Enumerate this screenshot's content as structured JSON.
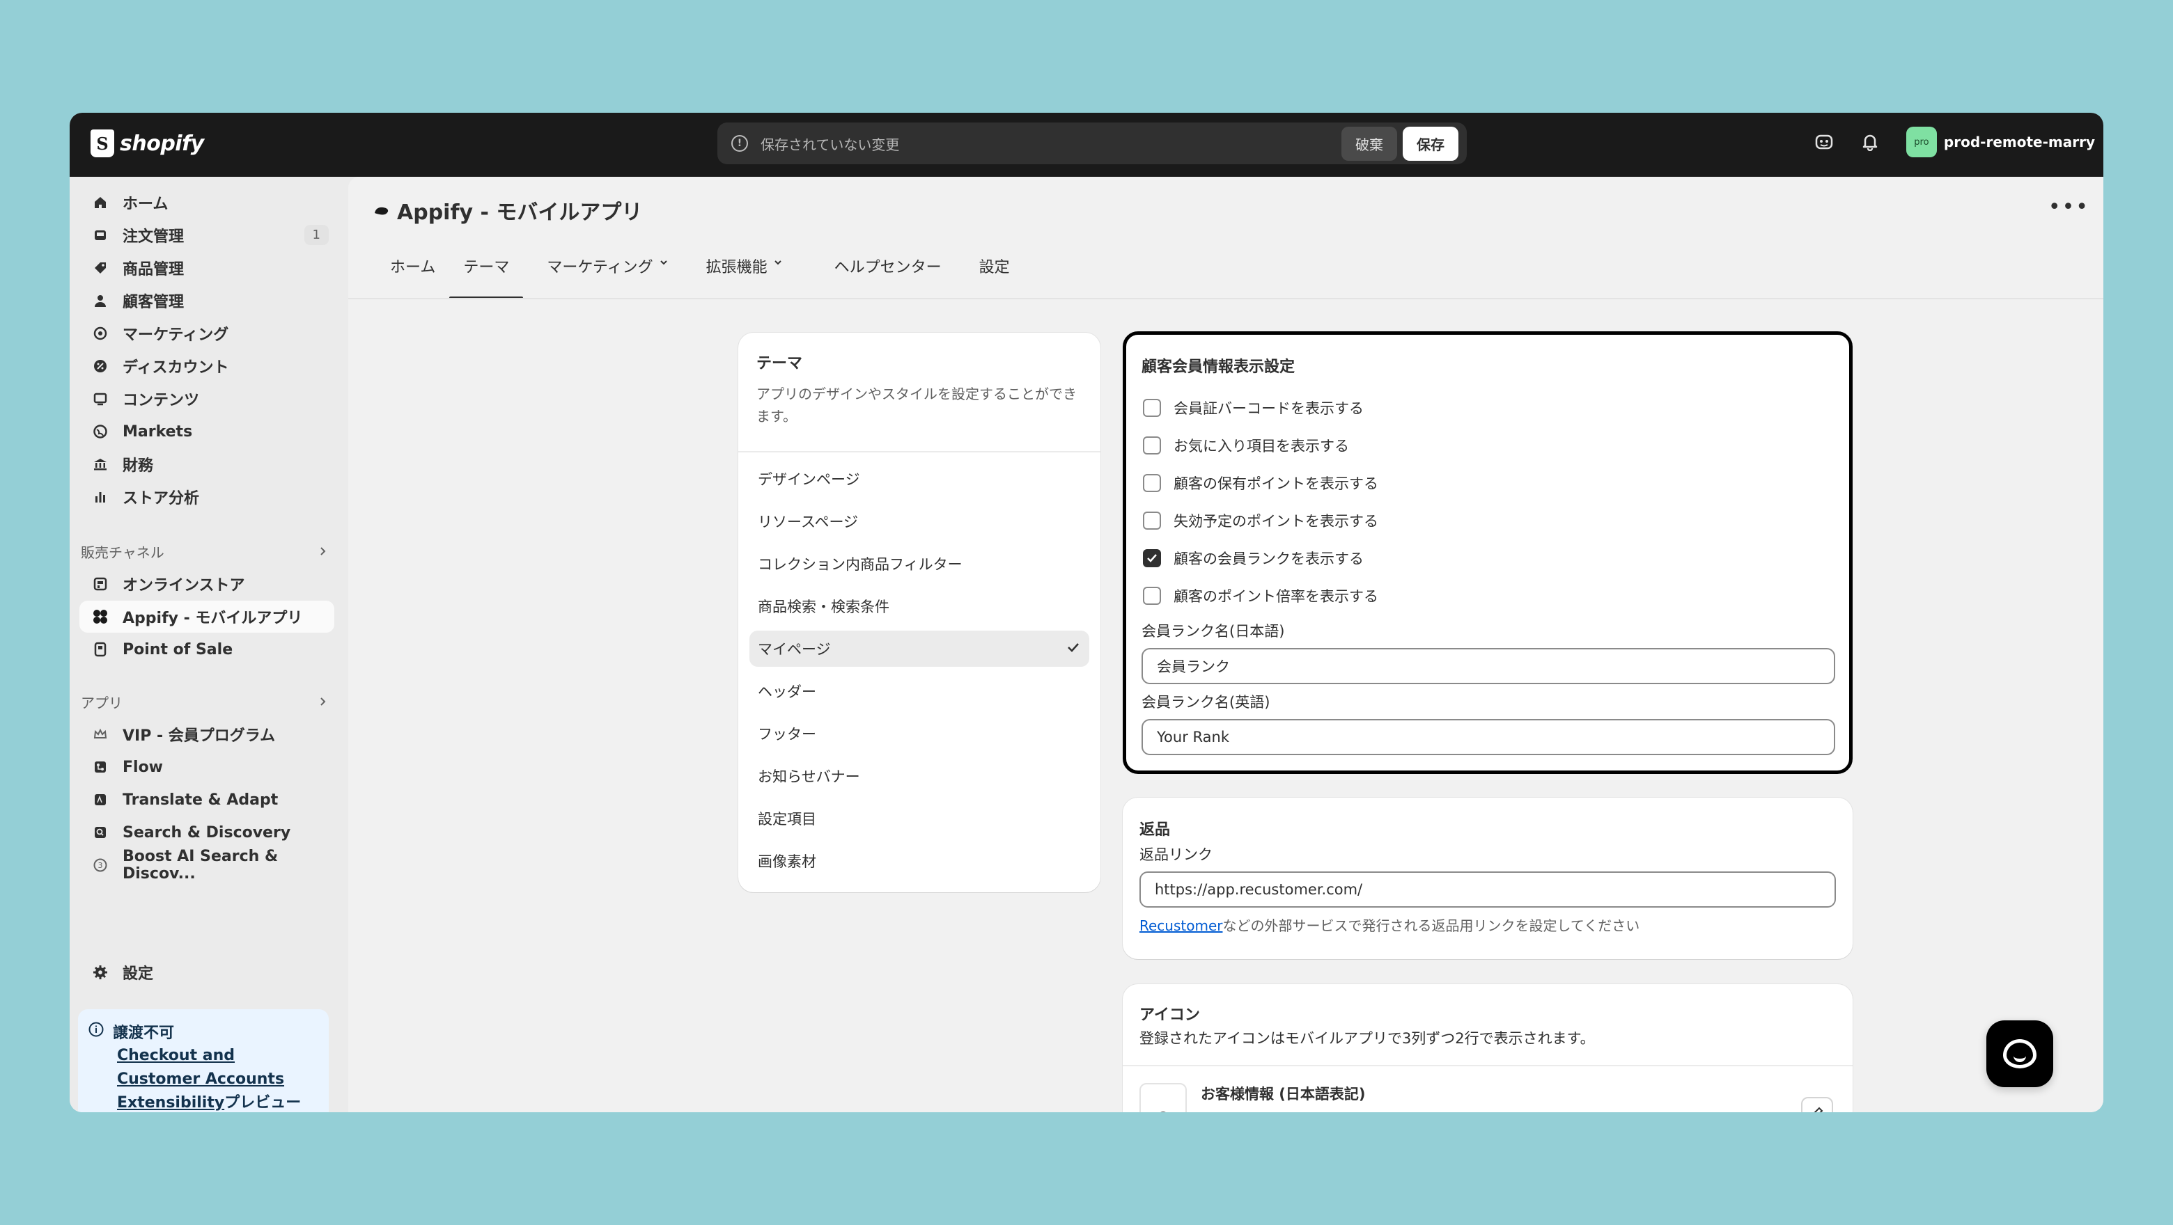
{
  "topbar": {
    "logo_text": "shopify",
    "savebar_text": "保存されていない変更",
    "discard_label": "破棄",
    "save_label": "保存",
    "avatar_text": "pro",
    "store_name": "prod-remote-marry"
  },
  "sidebar": {
    "items": [
      {
        "label": "ホーム",
        "icon": "home-icon"
      },
      {
        "label": "注文管理",
        "icon": "inbox-icon",
        "badge": "1"
      },
      {
        "label": "商品管理",
        "icon": "tag-icon"
      },
      {
        "label": "顧客管理",
        "icon": "person-icon"
      },
      {
        "label": "マーケティング",
        "icon": "target-icon"
      },
      {
        "label": "ディスカウント",
        "icon": "discount-icon"
      },
      {
        "label": "コンテンツ",
        "icon": "content-icon"
      },
      {
        "label": "Markets",
        "icon": "globe-icon"
      },
      {
        "label": "財務",
        "icon": "bank-icon"
      },
      {
        "label": "ストア分析",
        "icon": "chart-icon"
      }
    ],
    "sales_channels_label": "販売チャネル",
    "channels": [
      {
        "label": "オンラインストア",
        "icon": "store-icon"
      },
      {
        "label": "Appify - モバイルアプリ",
        "icon": "appify-icon"
      },
      {
        "label": "Point of Sale",
        "icon": "pos-icon"
      }
    ],
    "apps_label": "アプリ",
    "apps": [
      {
        "label": "VIP - 会員プログラム",
        "icon": "crown-icon"
      },
      {
        "label": "Flow",
        "icon": "flow-icon"
      },
      {
        "label": "Translate & Adapt",
        "icon": "translate-icon"
      },
      {
        "label": "Search & Discovery",
        "icon": "search-icon"
      },
      {
        "label": "Boost AI Search & Discov...",
        "icon": "boost-icon"
      }
    ],
    "settings_label": "設定",
    "notice": {
      "title": "譲渡不可",
      "link_text": "Checkout and Customer Accounts Extensibility",
      "suffix": "プレビュー"
    }
  },
  "main": {
    "app_title": "Appify - モバイルアプリ",
    "more_label": "•••",
    "tabs": [
      {
        "label": "ホーム"
      },
      {
        "label": "テーマ"
      },
      {
        "label": "マーケティング"
      },
      {
        "label": "拡張機能"
      },
      {
        "label": "ヘルプセンター"
      },
      {
        "label": "設定"
      }
    ],
    "theme_card": {
      "title": "テーマ",
      "description": "アプリのデザインやスタイルを設定することができます。",
      "items": [
        "デザインページ",
        "リソースページ",
        "コレクション内商品フィルター",
        "商品検索・検索条件",
        "マイページ",
        "ヘッダー",
        "フッター",
        "お知らせバナー",
        "設定項目",
        "画像素材"
      ]
    },
    "member_settings": {
      "title": "顧客会員情報表示設定",
      "checkboxes": [
        {
          "label": "会員証バーコードを表示する",
          "checked": false
        },
        {
          "label": "お気に入り項目を表示する",
          "checked": false
        },
        {
          "label": "顧客の保有ポイントを表示する",
          "checked": false
        },
        {
          "label": "失効予定のポイントを表示する",
          "checked": false
        },
        {
          "label": "顧客の会員ランクを表示する",
          "checked": true
        },
        {
          "label": "顧客のポイント倍率を表示する",
          "checked": false
        }
      ],
      "rank_name_ja_label": "会員ランク名(日本語)",
      "rank_name_ja_value": "会員ランク",
      "rank_name_en_label": "会員ランク名(英語)",
      "rank_name_en_value": "Your Rank"
    },
    "returns": {
      "title": "返品",
      "link_label": "返品リンク",
      "link_value": "https://app.recustomer.com/",
      "help_link": "Recustomer",
      "help_text": "などの外部サービスで発行される返品用リンクを設定してください"
    },
    "icons": {
      "title": "アイコン",
      "description": "登録されたアイコンはモバイルアプリで3列ずつ2行で表示されます。",
      "item_title": "お客様情報 (日本語表記)"
    }
  },
  "colors": {
    "background": "#94cfd6",
    "topbar": "#1a1a1a",
    "accent_link": "#005bd3",
    "avatar": "#7fe0a2"
  }
}
